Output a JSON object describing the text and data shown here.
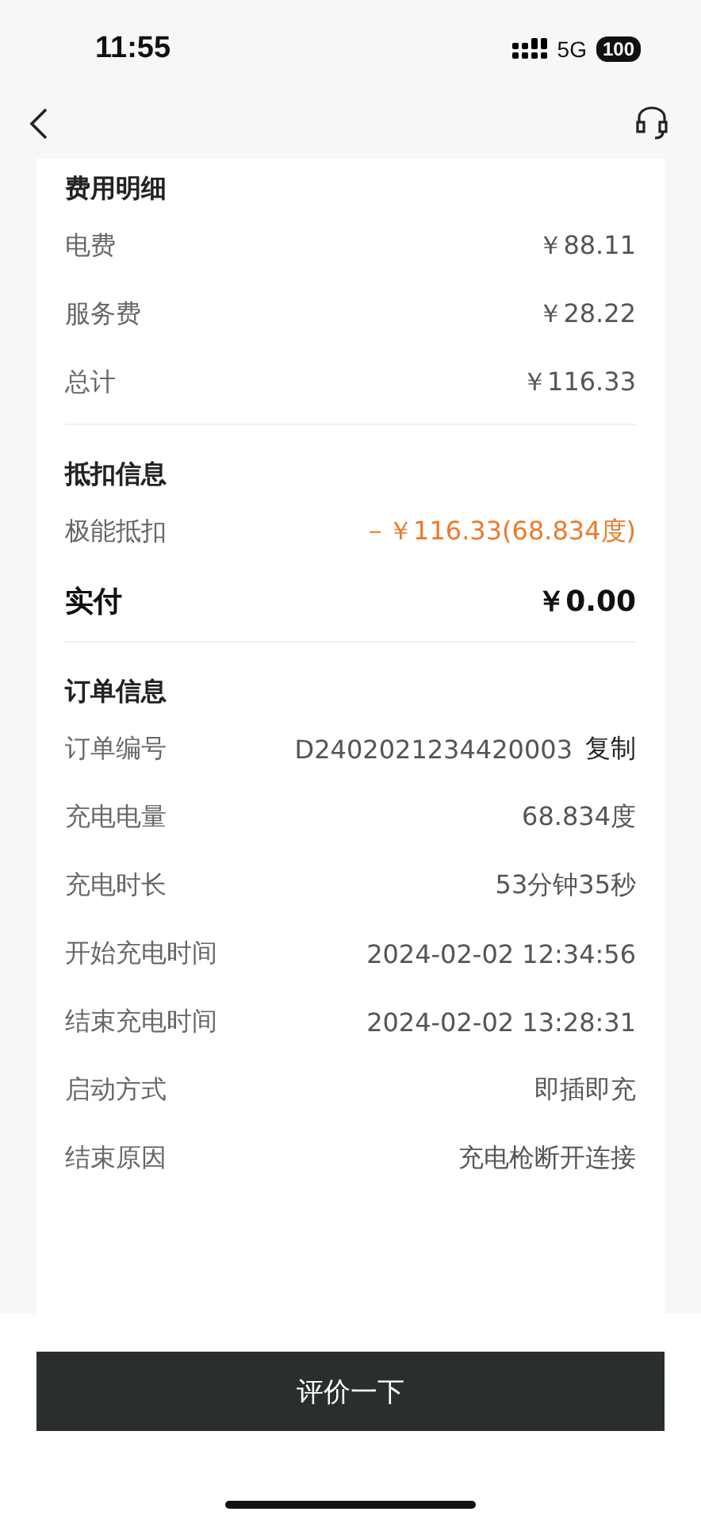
{
  "status_bar": {
    "time": "11:55",
    "network": "5G",
    "battery": "100"
  },
  "sections": [
    {
      "title": "费用明细",
      "rows": [
        {
          "label": "电费",
          "value": "￥88.11",
          "kind": "normal"
        },
        {
          "label": "服务费",
          "value": "￥28.22",
          "kind": "normal"
        },
        {
          "label": "总计",
          "value": "￥116.33",
          "kind": "normal"
        }
      ]
    },
    {
      "title": "抵扣信息",
      "rows": [
        {
          "label": "极能抵扣",
          "value": "－￥116.33(68.834度)",
          "kind": "deduction"
        },
        {
          "label": "实付",
          "value": "￥0.00",
          "kind": "total"
        }
      ]
    },
    {
      "title": "订单信息",
      "rows": [
        {
          "label": "订单编号",
          "value": "D2402021234420003",
          "kind": "normal",
          "action": "复制"
        },
        {
          "label": "充电电量",
          "value": "68.834度",
          "kind": "normal"
        },
        {
          "label": "充电时长",
          "value": "53分钟35秒",
          "kind": "normal"
        },
        {
          "label": "开始充电时间",
          "value": "2024-02-02 12:34:56",
          "kind": "normal"
        },
        {
          "label": "结束充电时间",
          "value": "2024-02-02 13:28:31",
          "kind": "normal"
        },
        {
          "label": "启动方式",
          "value": "即插即充",
          "kind": "normal"
        },
        {
          "label": "结束原因",
          "value": "充电枪断开连接",
          "kind": "normal"
        }
      ]
    }
  ],
  "button": "评价一下"
}
